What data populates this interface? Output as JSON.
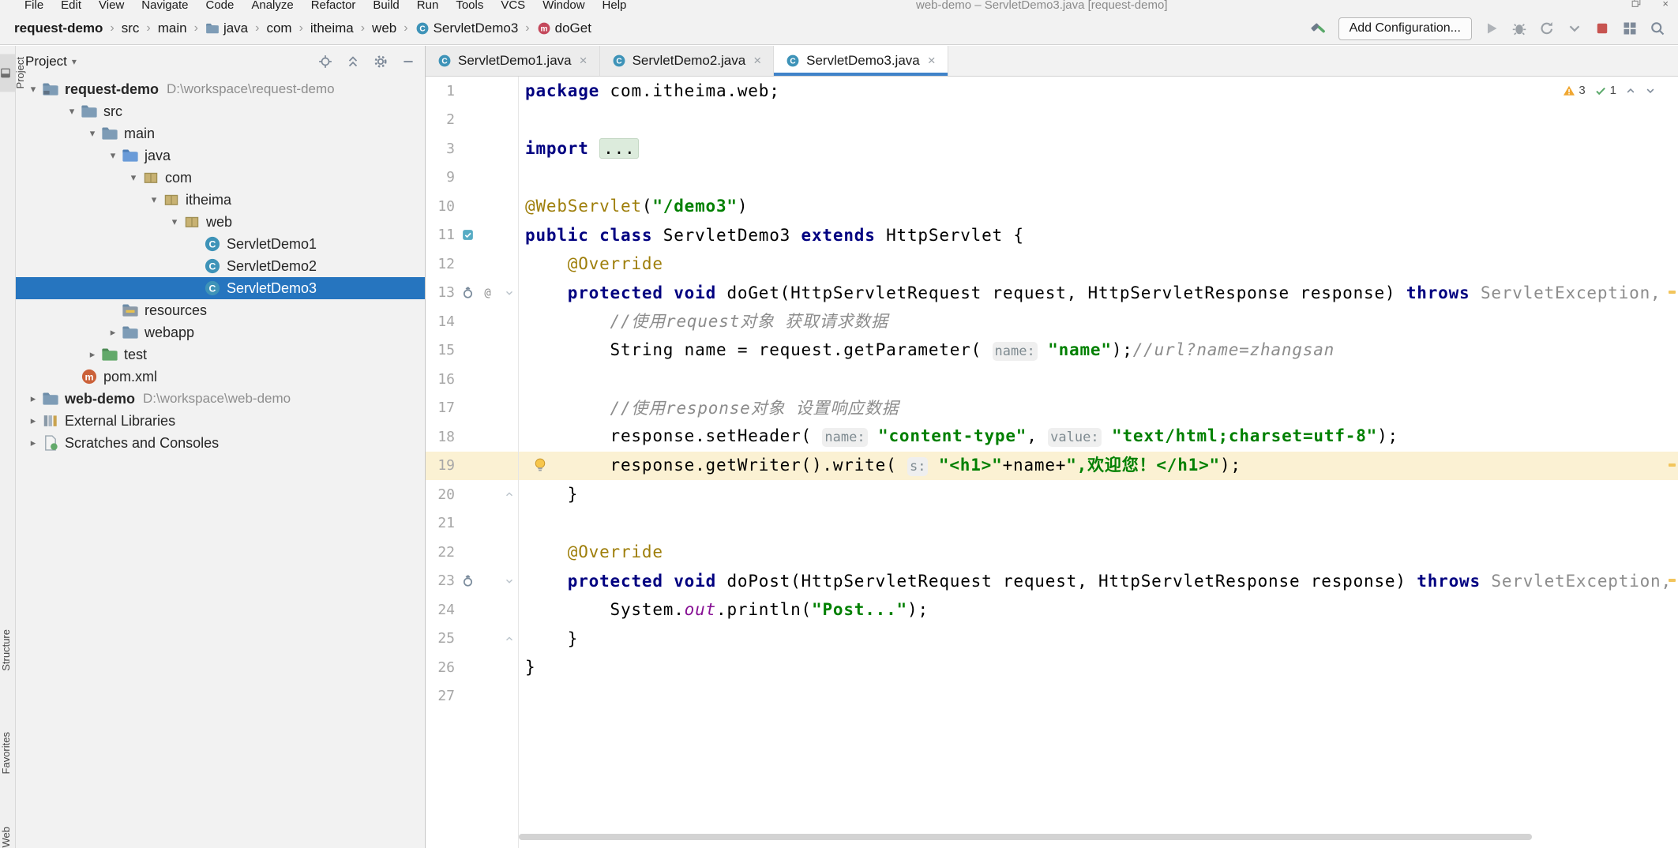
{
  "window": {
    "title": "web-demo – ServletDemo3.java [request-demo]"
  },
  "menu": {
    "items": [
      "File",
      "Edit",
      "View",
      "Navigate",
      "Code",
      "Analyze",
      "Refactor",
      "Build",
      "Run",
      "Tools",
      "VCS",
      "Window",
      "Help"
    ]
  },
  "toolbar": {
    "breadcrumbs": [
      {
        "label": "request-demo",
        "bold": true
      },
      {
        "label": "src"
      },
      {
        "label": "main"
      },
      {
        "label": "java",
        "icon": "folder"
      },
      {
        "label": "com"
      },
      {
        "label": "itheima"
      },
      {
        "label": "web"
      },
      {
        "label": "ServletDemo3",
        "icon": "class"
      },
      {
        "label": "doGet",
        "icon": "method"
      }
    ],
    "add_configuration": "Add Configuration...",
    "pre_icons": [
      "build-hammer"
    ],
    "post_icons": [
      "run-play",
      "debug-bug",
      "restart",
      "chevron-down",
      "stop",
      "layout-grid",
      "search"
    ]
  },
  "left_strip": {
    "items": [
      "Project",
      "Structure",
      "Favorites",
      "Web"
    ]
  },
  "project": {
    "header": {
      "title": "Project"
    },
    "tree": [
      {
        "depth": 0,
        "label": "request-demo",
        "path": "D:\\workspace\\request-demo",
        "icon": "project-folder",
        "chevron": "expanded",
        "bold": true
      },
      {
        "depth": 1,
        "label": "src",
        "icon": "folder",
        "chevron": "expanded"
      },
      {
        "depth": 2,
        "label": "main",
        "icon": "folder",
        "chevron": "expanded"
      },
      {
        "depth": 3,
        "label": "java",
        "icon": "source-folder",
        "chevron": "expanded"
      },
      {
        "depth": 4,
        "label": "com",
        "icon": "package",
        "chevron": "expanded"
      },
      {
        "depth": 5,
        "label": "itheima",
        "icon": "package",
        "chevron": "expanded"
      },
      {
        "depth": 6,
        "label": "web",
        "icon": "package",
        "chevron": "expanded"
      },
      {
        "depth": 7,
        "label": "ServletDemo1",
        "icon": "class"
      },
      {
        "depth": 7,
        "label": "ServletDemo2",
        "icon": "class"
      },
      {
        "depth": 7,
        "label": "ServletDemo3",
        "icon": "class",
        "selected": true
      },
      {
        "depth": 3,
        "label": "resources",
        "icon": "resources-folder"
      },
      {
        "depth": 3,
        "label": "webapp",
        "icon": "folder",
        "chevron": "collapsed"
      },
      {
        "depth": 2,
        "label": "test",
        "icon": "test-folder",
        "chevron": "collapsed"
      },
      {
        "depth": 1,
        "label": "pom.xml",
        "icon": "maven"
      },
      {
        "depth": 0,
        "label": "web-demo",
        "path": "D:\\workspace\\web-demo",
        "icon": "folder",
        "chevron": "collapsed",
        "bold": true
      },
      {
        "depth": 0,
        "label": "External Libraries",
        "icon": "library",
        "chevron": "collapsed"
      },
      {
        "depth": 0,
        "label": "Scratches and Consoles",
        "icon": "scratches",
        "chevron": "collapsed"
      }
    ]
  },
  "editor": {
    "tabs": [
      {
        "label": "ServletDemo1.java",
        "icon": "class"
      },
      {
        "label": "ServletDemo2.java",
        "icon": "class"
      },
      {
        "label": "ServletDemo3.java",
        "icon": "class",
        "active": true
      }
    ],
    "inspections": {
      "warnings": "3",
      "passed": "1"
    },
    "code": {
      "lines": [
        {
          "n": "1",
          "tk": [
            [
              "k",
              "package"
            ],
            [
              "p",
              " com.itheima.web;"
            ]
          ]
        },
        {
          "n": "2",
          "tk": []
        },
        {
          "n": "3",
          "tk": [
            [
              "k",
              "import"
            ],
            [
              "p",
              " "
            ],
            [
              "fo",
              "..."
            ]
          ]
        },
        {
          "n": "9",
          "tk": []
        },
        {
          "n": "10",
          "tk": [
            [
              "a",
              "@WebServlet"
            ],
            [
              "p",
              "("
            ],
            [
              "s",
              "\"/demo3\""
            ],
            [
              "p",
              ")"
            ]
          ]
        },
        {
          "n": "11",
          "g": [
            "class-marker"
          ],
          "tk": [
            [
              "k",
              "public"
            ],
            [
              "p",
              " "
            ],
            [
              "k",
              "class"
            ],
            [
              "p",
              " ServletDemo3 "
            ],
            [
              "k",
              "extends"
            ],
            [
              "p",
              " HttpServlet {"
            ]
          ]
        },
        {
          "n": "12",
          "tk": [
            [
              "p",
              "    "
            ],
            [
              "a",
              "@Override"
            ]
          ]
        },
        {
          "n": "13",
          "g": [
            "override",
            "at"
          ],
          "fold": "start",
          "tk": [
            [
              "p",
              "    "
            ],
            [
              "k",
              "protected"
            ],
            [
              "p",
              " "
            ],
            [
              "k",
              "void"
            ],
            [
              "p",
              " doGet(HttpServletRequest request, HttpServletResponse response) "
            ],
            [
              "k",
              "throws"
            ],
            [
              "p",
              " "
            ],
            [
              "d",
              "ServletException,"
            ]
          ]
        },
        {
          "n": "14",
          "tk": [
            [
              "p",
              "        "
            ],
            [
              "c",
              "//使用request对象 获取请求数据"
            ]
          ]
        },
        {
          "n": "15",
          "tk": [
            [
              "p",
              "        String name = request.getParameter( "
            ],
            [
              "h",
              "name:"
            ],
            [
              "p",
              " "
            ],
            [
              "s",
              "\"name\""
            ],
            [
              "p",
              ");"
            ],
            [
              "c",
              "//url?name=zhangsan"
            ]
          ]
        },
        {
          "n": "16",
          "tk": []
        },
        {
          "n": "17",
          "tk": [
            [
              "p",
              "        "
            ],
            [
              "c",
              "//使用response对象 设置响应数据"
            ]
          ]
        },
        {
          "n": "18",
          "tk": [
            [
              "p",
              "        response.setHeader( "
            ],
            [
              "h",
              "name:"
            ],
            [
              "p",
              " "
            ],
            [
              "s",
              "\"content-type\""
            ],
            [
              "p",
              ", "
            ],
            [
              "h",
              "value:"
            ],
            [
              "p",
              " "
            ],
            [
              "s",
              "\"text/html;charset=utf-8\""
            ],
            [
              "p",
              ");"
            ]
          ]
        },
        {
          "n": "19",
          "hl": true,
          "bulb": true,
          "tk": [
            [
              "p",
              "        response.getWriter().write( "
            ],
            [
              "h",
              "s:"
            ],
            [
              "p",
              " "
            ],
            [
              "s",
              "\"<h1>\""
            ],
            [
              "p",
              "+name+"
            ],
            [
              "s",
              "\",欢迎您！</h1>\""
            ],
            [
              "p",
              ");"
            ]
          ]
        },
        {
          "n": "20",
          "fold": "end",
          "tk": [
            [
              "p",
              "    }"
            ]
          ]
        },
        {
          "n": "21",
          "tk": []
        },
        {
          "n": "22",
          "tk": [
            [
              "p",
              "    "
            ],
            [
              "a",
              "@Override"
            ]
          ]
        },
        {
          "n": "23",
          "g": [
            "override"
          ],
          "fold": "start",
          "tk": [
            [
              "p",
              "    "
            ],
            [
              "k",
              "protected"
            ],
            [
              "p",
              " "
            ],
            [
              "k",
              "void"
            ],
            [
              "p",
              " doPost(HttpServletRequest request, HttpServletResponse response) "
            ],
            [
              "k",
              "throws"
            ],
            [
              "p",
              " "
            ],
            [
              "d",
              "ServletException,"
            ]
          ]
        },
        {
          "n": "24",
          "tk": [
            [
              "p",
              "        System."
            ],
            [
              "f",
              "out"
            ],
            [
              "p",
              ".println("
            ],
            [
              "s",
              "\"Post...\""
            ],
            [
              "p",
              ");"
            ]
          ]
        },
        {
          "n": "25",
          "fold": "end",
          "tk": [
            [
              "p",
              "    }"
            ]
          ]
        },
        {
          "n": "26",
          "tk": [
            [
              "p",
              "}"
            ]
          ]
        },
        {
          "n": "27",
          "tk": []
        }
      ]
    }
  }
}
